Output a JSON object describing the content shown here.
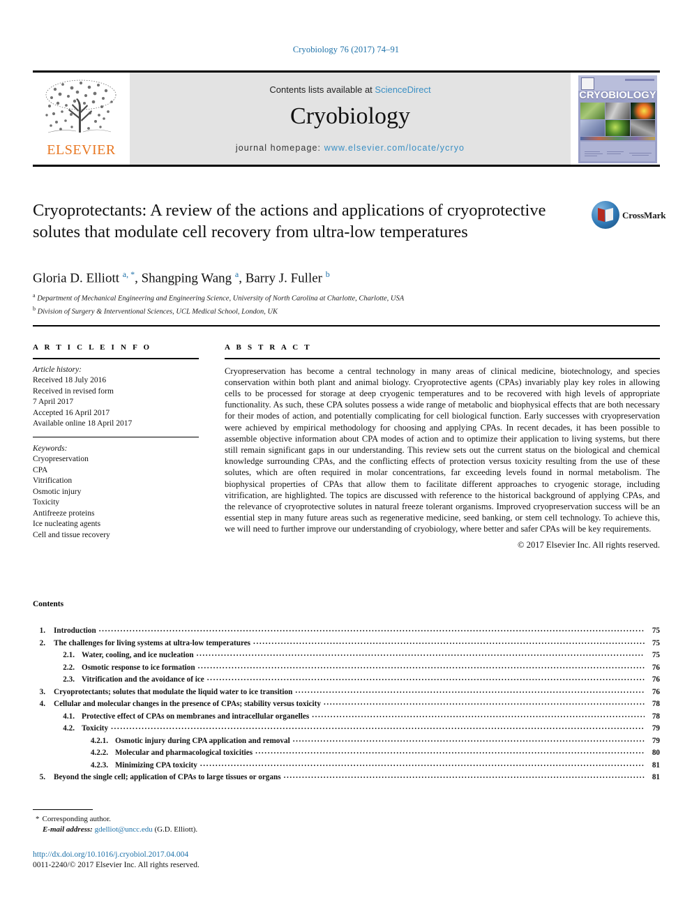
{
  "running_head": "Cryobiology 76 (2017) 74–91",
  "masthead": {
    "publisher_name": "ELSEVIER",
    "contents_prefix": "Contents lists available at ",
    "contents_link": "ScienceDirect",
    "journal_name": "Cryobiology",
    "homepage_prefix": "journal homepage: ",
    "homepage_link": "www.elsevier.com/locate/ycryo",
    "cover_title": "CRYOBIOLOGY"
  },
  "article": {
    "title": "Cryoprotectants: A review of the actions and applications of cryoprotective solutes that modulate cell recovery from ultra-low temperatures",
    "crossmark_label": "CrossMark",
    "authors_html": "Gloria D. Elliott <sup>a, *</sup>, Shangping Wang <sup>a</sup>, Barry J. Fuller <sup>b</sup>",
    "affiliations": [
      {
        "marker": "a",
        "text": "Department of Mechanical Engineering and Engineering Science, University of North Carolina at Charlotte, Charlotte, USA"
      },
      {
        "marker": "b",
        "text": "Division of Surgery & Interventional Sciences, UCL Medical School, London, UK"
      }
    ]
  },
  "article_info": {
    "heading": "A R T I C L E   I N F O",
    "history_label": "Article history:",
    "history_lines": [
      "Received 18 July 2016",
      "Received in revised form",
      "7 April 2017",
      "Accepted 16 April 2017",
      "Available online 18 April 2017"
    ],
    "keywords_label": "Keywords:",
    "keywords": [
      "Cryopreservation",
      "CPA",
      "Vitrification",
      "Osmotic injury",
      "Toxicity",
      "Antifreeze proteins",
      "Ice nucleating agents",
      "Cell and tissue recovery"
    ]
  },
  "abstract": {
    "heading": "A B S T R A C T",
    "text": "Cryopreservation has become a central technology in many areas of clinical medicine, biotechnology, and species conservation within both plant and animal biology. Cryoprotective agents (CPAs) invariably play key roles in allowing cells to be processed for storage at deep cryogenic temperatures and to be recovered with high levels of appropriate functionality. As such, these CPA solutes possess a wide range of metabolic and biophysical effects that are both necessary for their modes of action, and potentially complicating for cell biological function. Early successes with cryopreservation were achieved by empirical methodology for choosing and applying CPAs. In recent decades, it has been possible to assemble objective information about CPA modes of action and to optimize their application to living systems, but there still remain significant gaps in our understanding. This review sets out the current status on the biological and chemical knowledge surrounding CPAs, and the conflicting effects of protection versus toxicity resulting from the use of these solutes, which are often required in molar concentrations, far exceeding levels found in normal metabolism. The biophysical properties of CPAs that allow them to facilitate different approaches to cryogenic storage, including vitrification, are highlighted. The topics are discussed with reference to the historical background of applying CPAs, and the relevance of cryoprotective solutes in natural freeze tolerant organisms. Improved cryopreservation success will be an essential step in many future areas such as regenerative medicine, seed banking, or stem cell technology. To achieve this, we will need to further improve our understanding of cryobiology, where better and safer CPAs will be key requirements.",
    "copyright": "© 2017 Elsevier Inc. All rights reserved."
  },
  "contents": {
    "title": "Contents",
    "entries": [
      {
        "level": 1,
        "num": "1.",
        "label": "Introduction",
        "page": "75"
      },
      {
        "level": 1,
        "num": "2.",
        "label": "The challenges for living systems at ultra-low temperatures",
        "page": "75"
      },
      {
        "level": 2,
        "num": "2.1.",
        "label": "Water, cooling, and ice nucleation",
        "page": "75"
      },
      {
        "level": 2,
        "num": "2.2.",
        "label": "Osmotic response to ice formation",
        "page": "76"
      },
      {
        "level": 2,
        "num": "2.3.",
        "label": "Vitrification and the avoidance of ice",
        "page": "76"
      },
      {
        "level": 1,
        "num": "3.",
        "label": "Cryoprotectants; solutes that modulate the liquid water to ice transition",
        "page": "76"
      },
      {
        "level": 1,
        "num": "4.",
        "label": "Cellular and molecular changes in the presence of CPAs; stability versus toxicity",
        "page": "78"
      },
      {
        "level": 2,
        "num": "4.1.",
        "label": "Protective effect of CPAs on membranes and intracellular organelles",
        "page": "78"
      },
      {
        "level": 2,
        "num": "4.2.",
        "label": "Toxicity",
        "page": "79"
      },
      {
        "level": 3,
        "num": "4.2.1.",
        "label": "Osmotic injury during CPA application and removal",
        "page": "79"
      },
      {
        "level": 3,
        "num": "4.2.2.",
        "label": "Molecular and pharmacological toxicities",
        "page": "80"
      },
      {
        "level": 3,
        "num": "4.2.3.",
        "label": "Minimizing CPA toxicity",
        "page": "81"
      },
      {
        "level": 1,
        "num": "5.",
        "label": "Beyond the single cell; application of CPAs to large tissues or organs",
        "page": "81"
      }
    ]
  },
  "footnote": {
    "corresponding_marker": "*",
    "corresponding_text": "Corresponding author.",
    "email_label": "E-mail address:",
    "email": "gdelliot@uncc.edu",
    "email_suffix": "(G.D. Elliott)."
  },
  "doi": {
    "url": "http://dx.doi.org/10.1016/j.cryobiol.2017.04.004",
    "issn_line": "0011-2240/© 2017 Elsevier Inc. All rights reserved."
  },
  "colors": {
    "link_blue": "#1c70a8",
    "elsevier_orange": "#e87722",
    "band_gray": "#e3e3e3"
  }
}
